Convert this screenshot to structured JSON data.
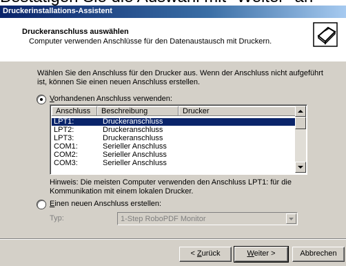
{
  "overlay_text": "Bestätigen Sie die Auswahl mit \"Weiter\" an",
  "window": {
    "title": "Druckerinstallations-Assistent"
  },
  "header": {
    "title": "Druckeranschluss auswählen",
    "subtitle": "Computer verwenden Anschlüsse für den Datenaustausch mit Druckern.",
    "icon": "printer-icon"
  },
  "intro": "Wählen Sie den Anschluss für den Drucker aus. Wenn der Anschluss nicht aufgeführt ist, können Sie einen neuen Anschluss erstellen.",
  "option_existing": {
    "underline": "V",
    "rest": "orhandenen Anschluss verwenden:",
    "selected": true
  },
  "ports": {
    "columns": [
      "Anschluss",
      "Beschreibung",
      "Drucker"
    ],
    "rows": [
      {
        "port": "LPT1:",
        "desc": "Druckeranschluss",
        "selected": true
      },
      {
        "port": "LPT2:",
        "desc": "Druckeranschluss",
        "selected": false
      },
      {
        "port": "LPT3:",
        "desc": "Druckeranschluss",
        "selected": false
      },
      {
        "port": "COM1:",
        "desc": "Serieller Anschluss",
        "selected": false
      },
      {
        "port": "COM2:",
        "desc": "Serieller Anschluss",
        "selected": false
      },
      {
        "port": "COM3:",
        "desc": "Serieller Anschluss",
        "selected": false
      }
    ]
  },
  "hint": "Hinweis: Die meisten Computer verwenden den Anschluss LPT1: für die Kommunikation mit einem lokalen Drucker.",
  "option_new": {
    "underline": "E",
    "rest": "inen neuen Anschluss erstellen:",
    "selected": false
  },
  "type": {
    "label": "Typ:",
    "value": "1-Step RoboPDF Monitor"
  },
  "buttons": {
    "back": {
      "prefix": "< ",
      "underline": "Z",
      "rest": "urück"
    },
    "next": {
      "underline": "W",
      "rest": "eiter >"
    },
    "cancel": "Abbrechen"
  }
}
